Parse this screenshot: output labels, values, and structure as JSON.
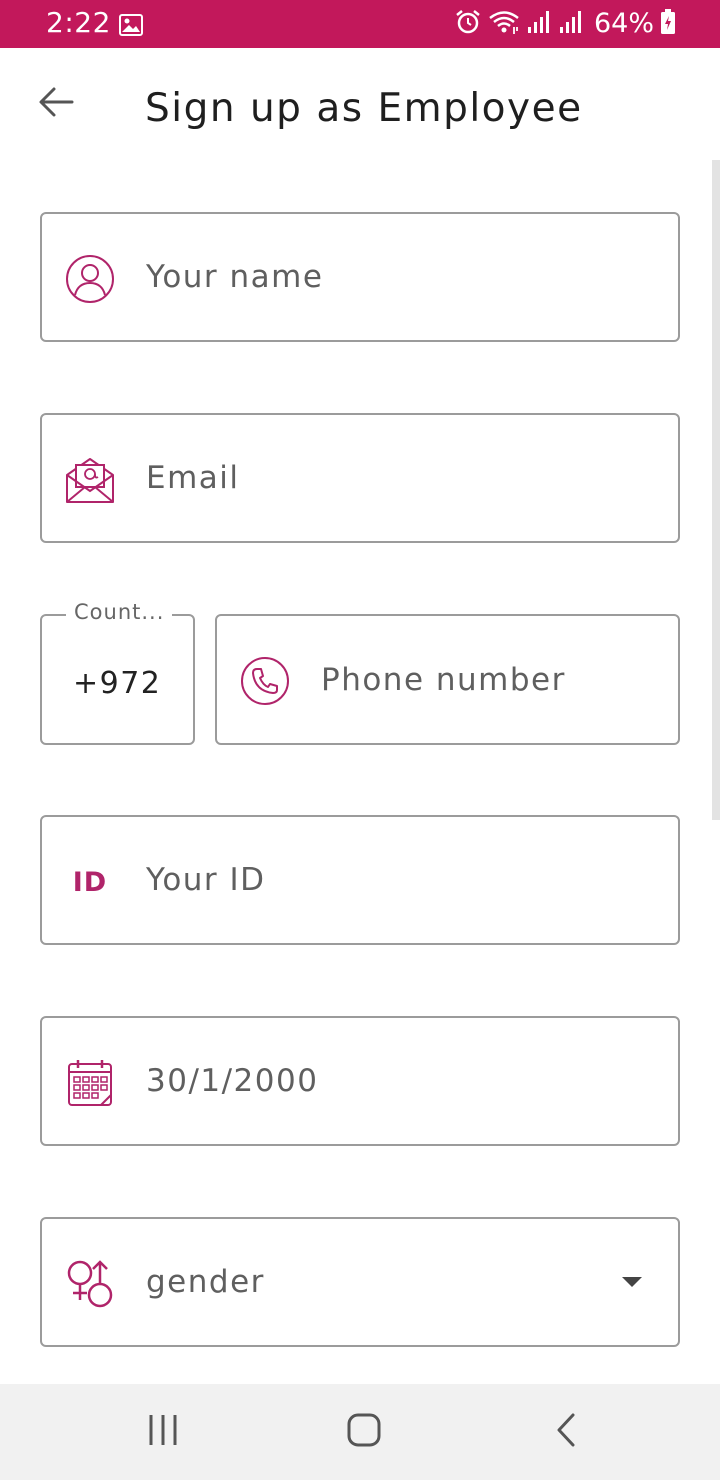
{
  "status_bar": {
    "time": "2:22",
    "battery": "64%",
    "icons": [
      "gallery-icon",
      "alarm-icon",
      "wifi-icon",
      "signal-icon",
      "signal-icon",
      "battery-charging-icon"
    ]
  },
  "header": {
    "title": "Sign up as Employee",
    "back_icon": "arrow-left-icon"
  },
  "form": {
    "name": {
      "placeholder": "Your name",
      "icon": "person-icon"
    },
    "email": {
      "placeholder": "Email",
      "icon": "envelope-icon"
    },
    "country": {
      "label": "Count...",
      "value": "+972"
    },
    "phone": {
      "placeholder": "Phone number",
      "icon": "phone-icon"
    },
    "id": {
      "badge": "ID",
      "placeholder": "Your ID"
    },
    "birthdate": {
      "value": "30/1/2000",
      "icon": "calendar-icon"
    },
    "gender": {
      "value": "gender",
      "icon": "gender-icon"
    }
  },
  "nav_bar": {
    "buttons": [
      "recents-icon",
      "home-icon",
      "back-icon"
    ]
  },
  "colors": {
    "accent": "#c2185b",
    "icon": "#b0246a",
    "border": "#9b9b9b"
  }
}
